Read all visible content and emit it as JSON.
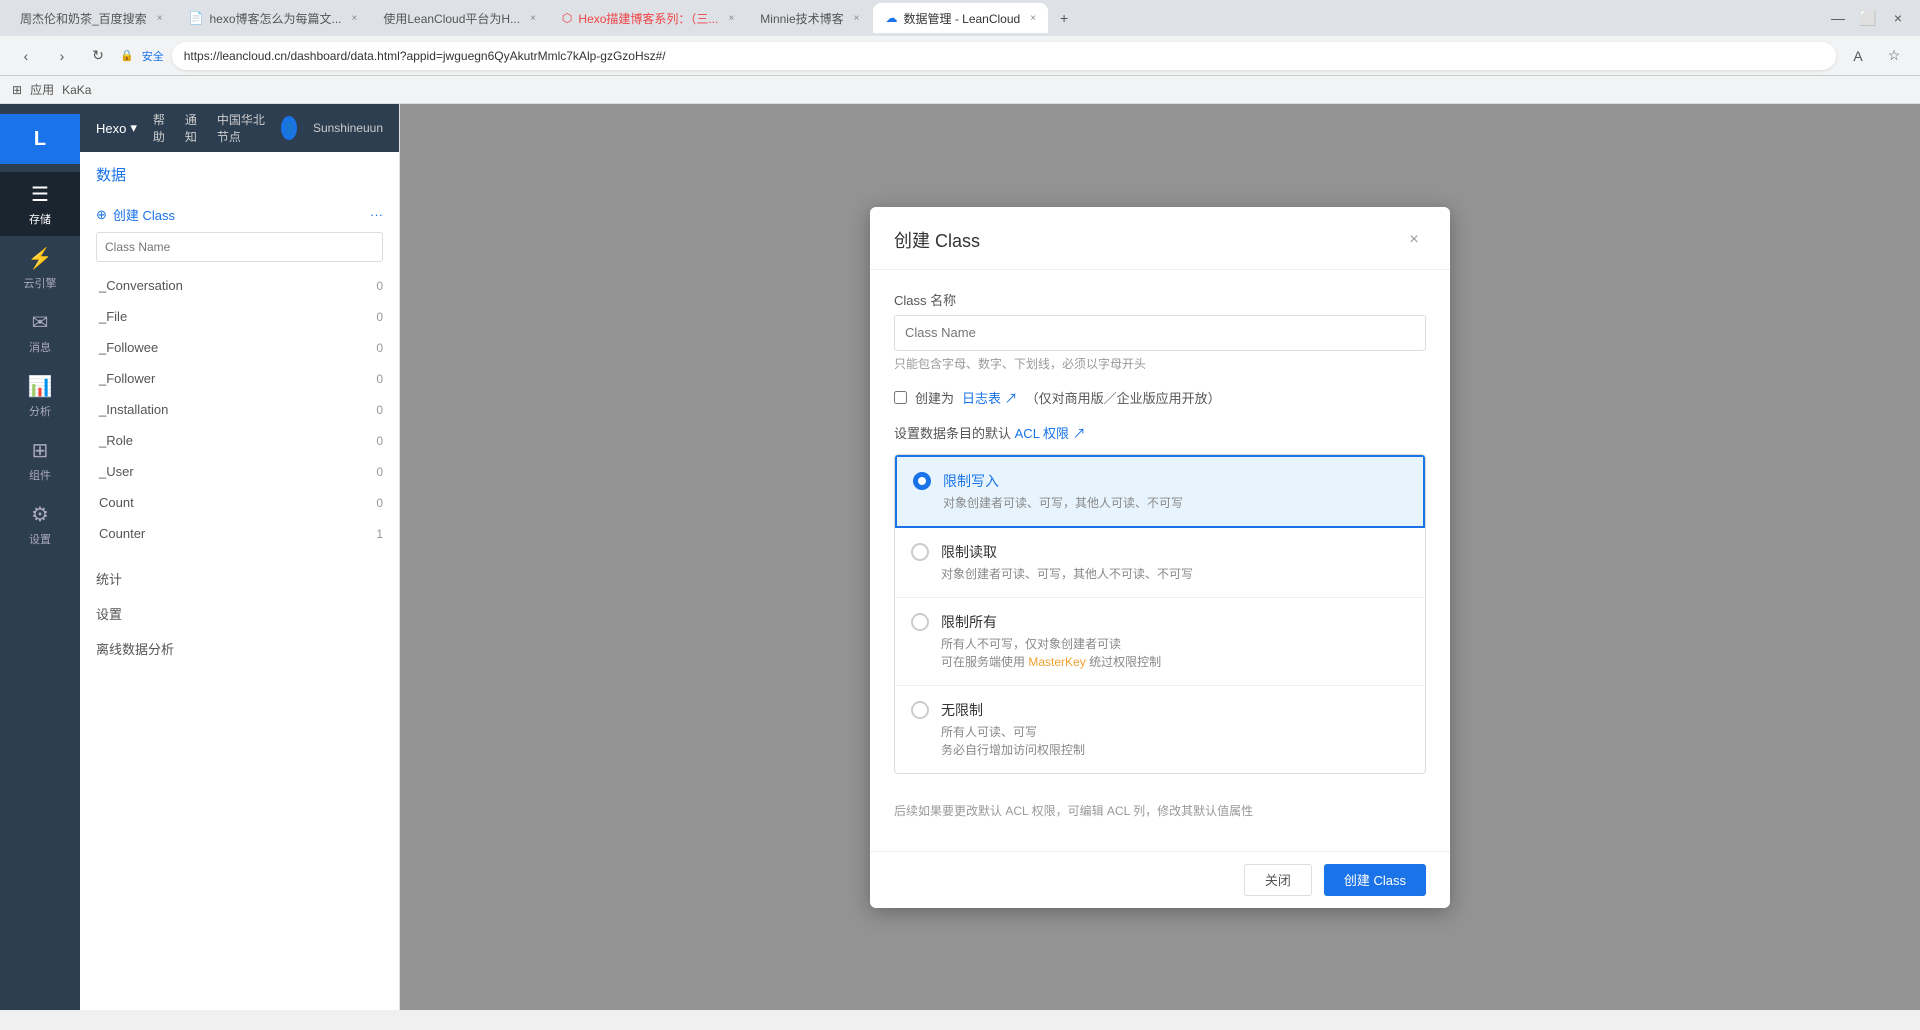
{
  "browser": {
    "tabs": [
      {
        "label": "周杰伦和奶茶_百度搜索",
        "active": false,
        "id": "tab1"
      },
      {
        "label": "hexo博客怎么为每篇文...",
        "active": false,
        "id": "tab2"
      },
      {
        "label": "使用LeanCloud平台为H...",
        "active": false,
        "id": "tab3"
      },
      {
        "label": "Hexo描建博客系列：（三...",
        "active": false,
        "id": "tab4"
      },
      {
        "label": "Minnie技术博客",
        "active": false,
        "id": "tab5"
      },
      {
        "label": "数据管理 - LeanCloud",
        "active": true,
        "id": "tab6"
      }
    ],
    "address": "https://leancloud.cn/dashboard/data.html?appid=jwguegn6QyAkutrMmlc7kAlp-gzGzoHsz#/",
    "security_label": "安全",
    "bookmarks_label": "应用",
    "bookmark_name": "KaKa"
  },
  "topnav": {
    "brand": "Hexo",
    "dropdown_icon": "▾",
    "help": "帮助",
    "notifications": "通知",
    "region": "中国华北节点",
    "user": "Sunshineuun"
  },
  "left_sidebar": {
    "logo": "L",
    "items": [
      {
        "label": "存储",
        "icon": "☰",
        "active": true,
        "id": "storage"
      },
      {
        "label": "云引擎",
        "icon": "⚡",
        "active": false,
        "id": "engine"
      },
      {
        "label": "消息",
        "icon": "✉",
        "active": false,
        "id": "message"
      },
      {
        "label": "分析",
        "icon": "📊",
        "active": false,
        "id": "analytics"
      },
      {
        "label": "组件",
        "icon": "⊞",
        "active": false,
        "id": "components"
      },
      {
        "label": "设置",
        "icon": "⚙",
        "active": false,
        "id": "settings"
      }
    ]
  },
  "data_sidebar": {
    "title": "数据",
    "create_btn": "创建 Class",
    "more_icon": "···",
    "search_placeholder": "Class Name",
    "classes": [
      {
        "name": "_Conversation",
        "count": 0
      },
      {
        "name": "_File",
        "count": 0
      },
      {
        "name": "_Followee",
        "count": 0
      },
      {
        "name": "_Follower",
        "count": 0
      },
      {
        "name": "_Installation",
        "count": 0
      },
      {
        "name": "_Role",
        "count": 0
      },
      {
        "name": "_User",
        "count": 0
      },
      {
        "name": "Count",
        "count": 0
      },
      {
        "name": "Counter",
        "count": 1
      }
    ],
    "bottom_items": [
      "统计",
      "设置",
      "离线数据分析"
    ]
  },
  "modal": {
    "title": "创建 Class",
    "close_icon": "×",
    "class_name_label": "Class 名称",
    "class_name_placeholder": "Class Name",
    "class_name_hint": "只能包含字母、数字、下划线，必须以字母开头",
    "log_table_label": "创建为",
    "log_table_link": "日志表",
    "log_table_note": "（仅对商用版／企业版应用开放）",
    "acl_section_label": "设置数据条目的默认",
    "acl_link": "ACL 权限",
    "acl_options": [
      {
        "id": "restrict_write",
        "title": "限制写入",
        "desc": "对象创建者可读、可写，其他人可读、不可写",
        "selected": true
      },
      {
        "id": "restrict_read",
        "title": "限制读取",
        "desc": "对象创建者可读、可写，其他人不可读、不可写",
        "selected": false
      },
      {
        "id": "restrict_all",
        "title": "限制所有",
        "desc_line1": "所有人不可写，仅对象创建者可读",
        "desc_line2": "可在服务端使用",
        "masterkey": "MasterKey",
        "desc_line3": "统过权限控制",
        "selected": false
      },
      {
        "id": "unrestricted",
        "title": "无限制",
        "desc_line1": "所有人可读、可写",
        "desc_line2": "务必自行增加访问权限控制",
        "selected": false
      }
    ],
    "acl_footer_note": "后续如果要更改默认 ACL 权限，可编辑 ACL 列，修改其默认值属性",
    "cancel_btn": "关闭",
    "submit_btn": "创建 Class"
  }
}
